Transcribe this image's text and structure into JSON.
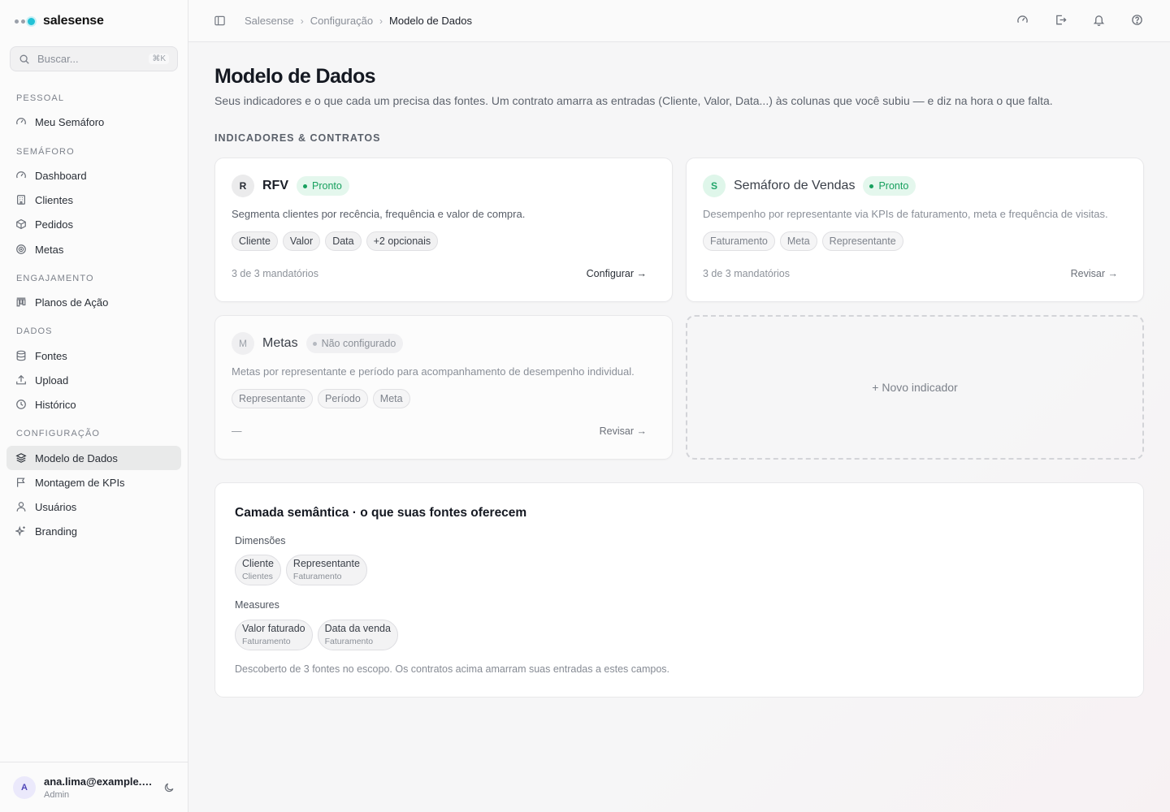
{
  "brand": {
    "name": "salesense",
    "accent_color": "#22c2d6"
  },
  "search": {
    "placeholder": "Buscar...",
    "shortcut": "⌘K"
  },
  "sidebar": {
    "sections": [
      {
        "title": "PESSOAL"
      },
      {
        "title": "SEMÁFORO"
      },
      {
        "title": "ENGAJAMENTO"
      },
      {
        "title": "DADOS"
      },
      {
        "title": "CONFIGURAÇÃO"
      }
    ],
    "items": [
      {
        "label": "Meu Semáforo",
        "icon": "gauge-icon"
      },
      {
        "label": "Dashboard",
        "icon": "gauge-icon"
      },
      {
        "label": "Clientes",
        "icon": "building-icon"
      },
      {
        "label": "Pedidos",
        "icon": "package-icon"
      },
      {
        "label": "Metas",
        "icon": "target-icon"
      },
      {
        "label": "Planos de Ação",
        "icon": "kanban-icon"
      },
      {
        "label": "Fontes",
        "icon": "database-icon"
      },
      {
        "label": "Upload",
        "icon": "upload-icon"
      },
      {
        "label": "Histórico",
        "icon": "clock-icon"
      },
      {
        "label": "Modelo de Dados",
        "icon": "layers-icon",
        "active": true
      },
      {
        "label": "Montagem de KPIs",
        "icon": "flag-icon"
      },
      {
        "label": "Usuários",
        "icon": "user-icon"
      },
      {
        "label": "Branding",
        "icon": "sparkles-icon"
      }
    ]
  },
  "user": {
    "initial": "A",
    "email": "ana.lima@example.com",
    "role": "Admin"
  },
  "breadcrumb": {
    "items": [
      "Salesense",
      "Configuração"
    ],
    "separator": "›",
    "current": "Modelo de Dados"
  },
  "page": {
    "title": "Modelo de Dados",
    "description": "Seus indicadores e o que cada um precisa das fontes. Um contrato amarra as entradas (Cliente, Valor, Data...) às colunas que você subiu — e diz na hora o que falta.",
    "group_title": "INDICADORES & CONTRATOS"
  },
  "indicators": [
    {
      "initial": "R",
      "name": "RFV",
      "status": "Pronto",
      "status_color": "#17a05e",
      "description": "Segmenta clientes por recência, frequência e valor de compra.",
      "chips": [
        "Cliente",
        "Valor",
        "Data",
        "+2 opcionais"
      ],
      "mandatory": "3 de 3 mandatórios",
      "action": "Configurar →"
    },
    {
      "initial": "S",
      "name": "Semáforo de Vendas",
      "status": "Pronto",
      "status_color": "#17a05e",
      "description": "Desempenho por representante via KPIs de faturamento, meta e frequência de visitas.",
      "chips": [
        "Faturamento",
        "Meta",
        "Representante"
      ],
      "mandatory": "3 de 3 mandatórios",
      "action": "Revisar →"
    },
    {
      "initial": "M",
      "name": "Metas",
      "status": "Não configurado",
      "status_color": "#8b9098",
      "description": "Metas por representante e período para acompanhamento de desempenho individual.",
      "chips": [
        "Representante",
        "Período",
        "Meta"
      ],
      "mandatory": "—",
      "action": "Revisar →"
    }
  ],
  "new_indicator": {
    "label": "+ Novo indicador"
  },
  "semantic": {
    "title": "Camada semântica · o que suas fontes oferecem",
    "dimensions_label": "Dimensões",
    "dimensions": [
      {
        "name": "Cliente",
        "source": "Clientes"
      },
      {
        "name": "Representante",
        "source": "Faturamento"
      }
    ],
    "measures_label": "Measures",
    "measures": [
      {
        "name": "Valor faturado",
        "source": "Faturamento"
      },
      {
        "name": "Data da venda",
        "source": "Faturamento"
      }
    ],
    "footer": "Descoberto de 3 fontes no escopo. Os contratos acima amarram suas entradas a estes campos."
  }
}
